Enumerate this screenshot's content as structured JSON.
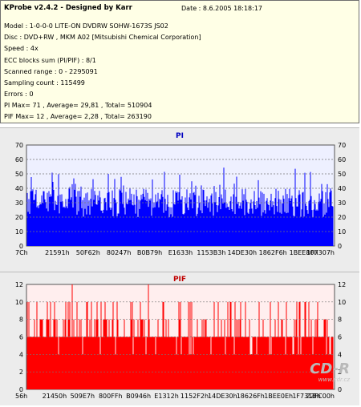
{
  "info": {
    "header": "KProbe v2.4.2 - Designed by Karr",
    "date": "Date : 8.6.2005 18:18:17",
    "lines": [
      "Model : 1-0-0-0 LITE-ON DVDRW SOHW-1673S JS02",
      "Disc : DVD+RW , MKM A02 [Mitsubishi Chemical Corporation]",
      "Speed : 4x",
      "ECC blocks sum (PI/PIF) : 8/1",
      "Scanned range : 0 - 2295091",
      "Sampling count : 115499",
      "Errors : 0",
      "PI Max= 71 , Average= 29,81 , Total= 510904",
      "PIF Max= 12 , Average= 2,28 , Total= 263190"
    ]
  },
  "watermark": {
    "logo": "CD-R",
    "url": "www.cdr.cz"
  },
  "colors": {
    "pi": "#0000ff",
    "pif": "#ff0000",
    "plot_bg_pi": "#eef0ff",
    "plot_bg_pif": "#ffeeee"
  },
  "chart_data": [
    {
      "type": "bar",
      "title": "PI",
      "ylim": [
        0,
        70
      ],
      "yticks": [
        0,
        10,
        20,
        30,
        40,
        50,
        60,
        70
      ],
      "xticklabels": [
        "7Ch",
        "21591h",
        "50F62h",
        "80247h",
        "B0B79h",
        "E1633h",
        "1153B3h",
        "14DE30h",
        "1862F6h",
        "1BEE80h",
        "1F7307h"
      ],
      "max": 71,
      "average": 29.81,
      "grid": "dashed horizontal"
    },
    {
      "type": "bar",
      "title": "PIF",
      "ylim": [
        0,
        12
      ],
      "yticks": [
        0,
        2,
        4,
        6,
        8,
        10,
        12
      ],
      "xticklabels": [
        "56h",
        "21450h",
        "509E7h",
        "800FFh",
        "B0946h",
        "E1312h",
        "1152F2h",
        "14DE30h",
        "18626Fh",
        "1BEE0Eh",
        "1F731Bh",
        "22FC00h"
      ],
      "max": 12,
      "average": 2.28,
      "grid": "dashed horizontal"
    }
  ]
}
